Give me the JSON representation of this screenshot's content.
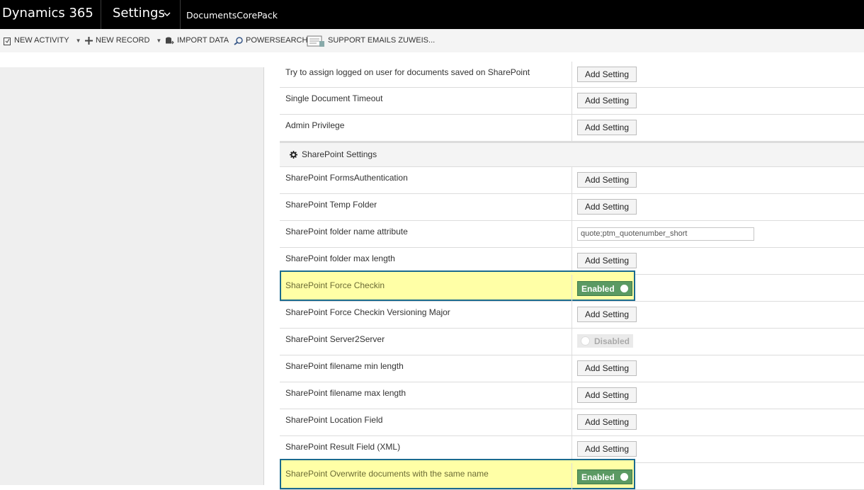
{
  "topbar": {
    "brand": "Dynamics 365",
    "area": "Settings",
    "entity": "DocumentsCorePack"
  },
  "commands": [
    {
      "label": "NEW ACTIVITY",
      "icon": "new-activity-icon"
    },
    {
      "label": "NEW RECORD",
      "icon": "plus-icon"
    },
    {
      "label": "IMPORT DATA",
      "icon": "import-data-icon"
    },
    {
      "label": "POWERSEARCH",
      "icon": "powersearch-icon"
    },
    {
      "label": "SUPPORT EMAILS ZUWEIS...",
      "icon": "support-email-icon"
    }
  ],
  "add_label": "Add Setting",
  "rows": [
    {
      "label": "Try to assign logged on user for documents saved on SharePoint"
    },
    {
      "label": "Single Document Timeout"
    },
    {
      "label": "Admin Privilege"
    }
  ],
  "section": {
    "label": "SharePoint Settings",
    "icon": "gear-icon"
  },
  "sp_rows": [
    {
      "label": "SharePoint FormsAuthentication"
    },
    {
      "label": "SharePoint Temp Folder"
    },
    {
      "label": "SharePoint folder name attribute",
      "value": "quote;ptm_quotenumber_short"
    },
    {
      "label": "SharePoint folder max length"
    },
    {
      "label": "SharePoint Force Checkin",
      "toggle": "Enabled"
    },
    {
      "label": "SharePoint Force Checkin Versioning Major"
    },
    {
      "label": "SharePoint Server2Server",
      "toggle": "Disabled"
    },
    {
      "label": "SharePoint filename min length"
    },
    {
      "label": "SharePoint filename max length"
    },
    {
      "label": "SharePoint Location Field"
    },
    {
      "label": "SharePoint Result Field (XML)"
    },
    {
      "label": "SharePoint Overwrite documents with the same name",
      "toggle": "Enabled"
    }
  ],
  "colors": {
    "highlight": "#ffffa6",
    "highlight_border": "#1b6b8e",
    "enabled": "#5b9a63"
  }
}
